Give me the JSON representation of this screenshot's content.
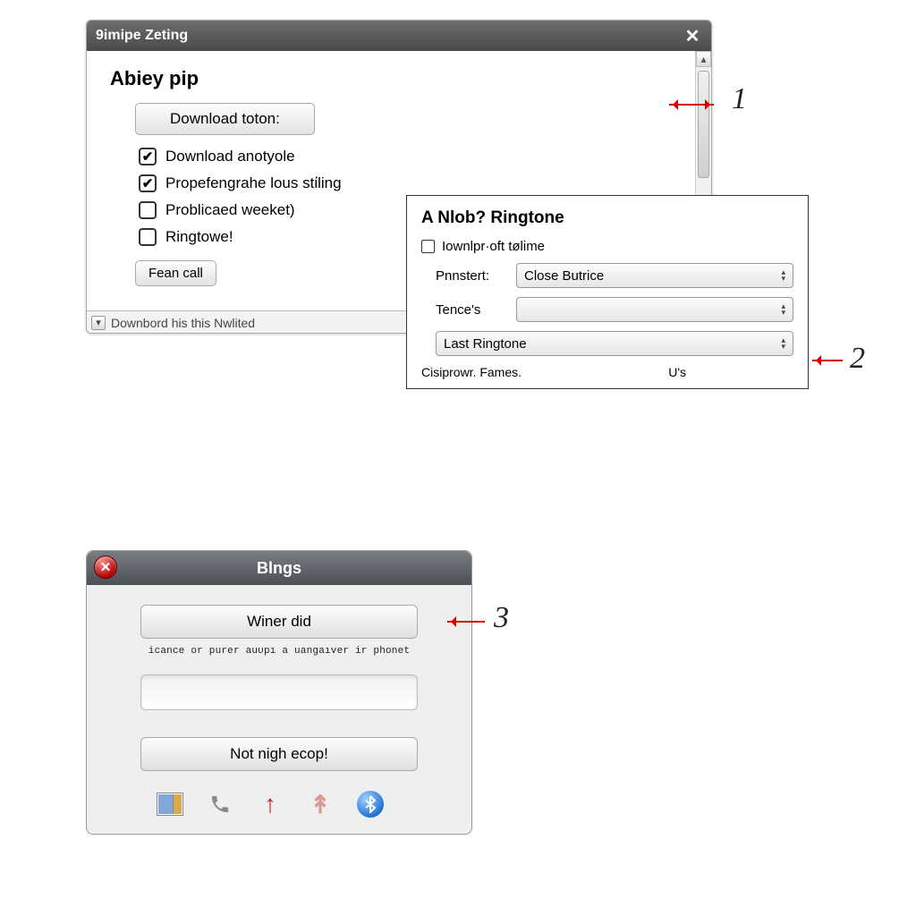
{
  "callouts": {
    "n1": "1",
    "n2": "2",
    "n3": "3"
  },
  "win1": {
    "title": "9imipe Zeting",
    "heading": "Abiey pip",
    "download_btn": "Download toton:",
    "options": [
      {
        "label": "Download anotyole",
        "checked": true
      },
      {
        "label": "Propefengrahe lous stίling",
        "checked": true
      },
      {
        "label": "Problicaed weeket)",
        "checked": false
      },
      {
        "label": "Ringtowe!",
        "checked": false
      }
    ],
    "action_btn": "Fean call",
    "status_text": "Downbord his this Nwlited"
  },
  "panel2": {
    "heading": "A Nlob? Ringtone",
    "checkbox_label": "Iownlpr·oft tølime",
    "row1_label": "Pnnstert:",
    "row1_value": "Close Butrice",
    "row2_label": "Tence's",
    "row2_value": "",
    "row3_value": "Last Ringtone",
    "footer_left": "Cisiprowr. Fames.",
    "footer_right": "U's"
  },
  "win3": {
    "title": "Blngs",
    "primary_btn": "Winer did",
    "caption": "icance or purer auυpı a uangaıver ir phonet",
    "secondary_btn": "Not nigh ecop!",
    "icons": {
      "picture": "picture-icon",
      "phone": "phone-icon",
      "up1": "arrow-up-icon",
      "up2": "arrow-up-faded-icon",
      "bluetooth": "bluetooth-icon"
    }
  }
}
